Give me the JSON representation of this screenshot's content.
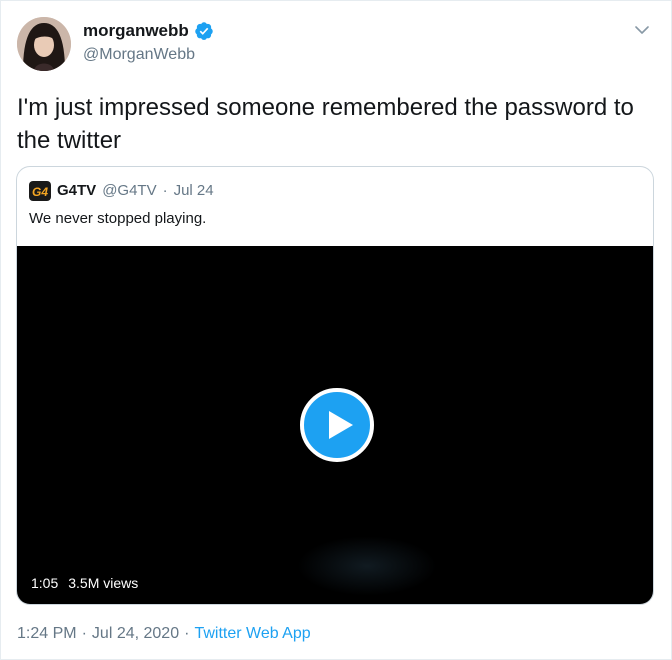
{
  "author": {
    "name": "morganwebb",
    "handle": "@MorganWebb",
    "verified": true,
    "avatar_icon": "avatar-photo"
  },
  "tweet": {
    "text": "I'm just impressed someone remembered the password to the twitter"
  },
  "quoted_tweet": {
    "logo_text": "G4",
    "name": "G4TV",
    "handle": "@G4TV",
    "separator": "·",
    "date": "Jul 24",
    "text": "We never stopped playing.",
    "video": {
      "duration": "1:05",
      "views": "3.5M views"
    }
  },
  "footer": {
    "time": "1:24 PM",
    "sep1": "·",
    "date": "Jul 24, 2020",
    "sep2": "·",
    "source": "Twitter Web App"
  },
  "colors": {
    "accent": "#1da1f2",
    "secondary_text": "#657786",
    "border": "#ccd6dd"
  }
}
